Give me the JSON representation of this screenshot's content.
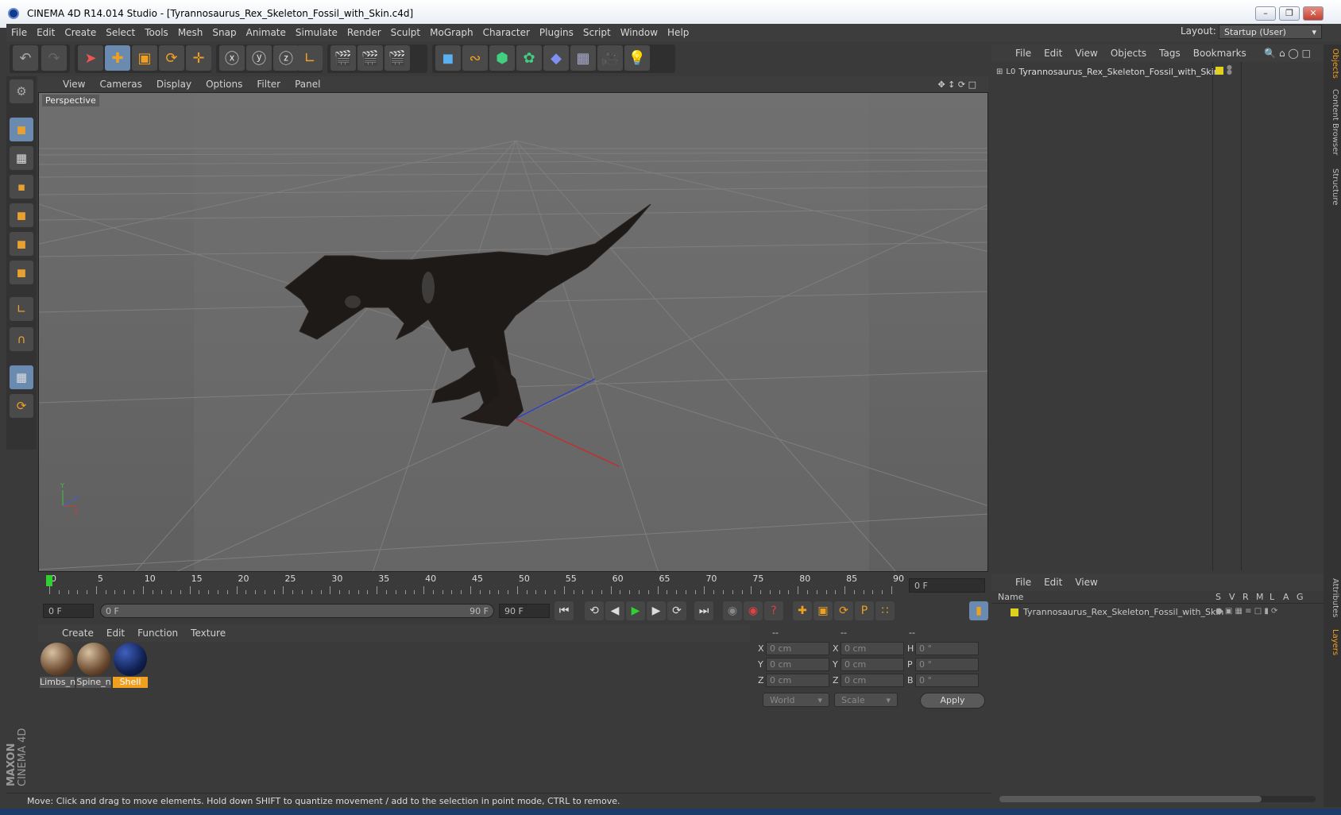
{
  "window": {
    "title": "CINEMA 4D R14.014 Studio - [Tyrannosaurus_Rex_Skeleton_Fossil_with_Skin.c4d]"
  },
  "menubar": {
    "items": [
      "File",
      "Edit",
      "Create",
      "Select",
      "Tools",
      "Mesh",
      "Snap",
      "Animate",
      "Simulate",
      "Render",
      "Sculpt",
      "MoGraph",
      "Character",
      "Plugins",
      "Script",
      "Window",
      "Help"
    ]
  },
  "layout": {
    "label": "Layout:",
    "value": "Startup (User)"
  },
  "viewport": {
    "menu": [
      "View",
      "Cameras",
      "Display",
      "Options",
      "Filter",
      "Panel"
    ],
    "label": "Perspective"
  },
  "timeline": {
    "ticks": [
      "0",
      "5",
      "10",
      "15",
      "20",
      "25",
      "30",
      "35",
      "40",
      "45",
      "50",
      "55",
      "60",
      "65",
      "70",
      "75",
      "80",
      "85",
      "90"
    ],
    "current_frame": "0 F",
    "start_field": "0 F",
    "range_start": "0 F",
    "range_end": "90 F",
    "end_field": "90 F"
  },
  "materials": {
    "menu": [
      "Create",
      "Edit",
      "Function",
      "Texture"
    ],
    "items": [
      {
        "name": "Limbs_n"
      },
      {
        "name": "Spine_n"
      },
      {
        "name": "Shell"
      }
    ]
  },
  "coords": {
    "headers": [
      "--",
      "--",
      "--"
    ],
    "rows": [
      {
        "a": "X",
        "av": "0 cm",
        "b": "X",
        "bv": "0 cm",
        "c": "H",
        "cv": "0 °"
      },
      {
        "a": "Y",
        "av": "0 cm",
        "b": "Y",
        "bv": "0 cm",
        "c": "P",
        "cv": "0 °"
      },
      {
        "a": "Z",
        "av": "0 cm",
        "b": "Z",
        "bv": "0 cm",
        "c": "B",
        "cv": "0 °"
      }
    ],
    "mode": "World",
    "transform": "Scale",
    "apply": "Apply"
  },
  "status": "Move: Click and drag to move elements. Hold down SHIFT to quantize movement / add to the selection in point mode, CTRL to remove.",
  "objects": {
    "menu": [
      "File",
      "Edit",
      "View",
      "Objects",
      "Tags",
      "Bookmarks"
    ],
    "items": [
      {
        "name": "Tyrannosaurus_Rex_Skeleton_Fossil_with_Skin"
      }
    ]
  },
  "layers": {
    "menu": [
      "File",
      "Edit",
      "View"
    ],
    "header": {
      "name": "Name",
      "cols": [
        "S",
        "V",
        "R",
        "M",
        "L",
        "A",
        "G"
      ]
    },
    "items": [
      {
        "name": "Tyrannosaurus_Rex_Skeleton_Fossil_with_Skin"
      }
    ]
  },
  "sidetabs": [
    "Objects",
    "Content Browser",
    "Structure",
    "Attributes",
    "Layers"
  ],
  "branding": {
    "maxon": "MAXON",
    "product": "CINEMA 4D"
  },
  "colors": {
    "accent": "#f0a020",
    "ui_bg": "#3a3a3a",
    "viewport_bg": "#6a6a6a",
    "layer_color": "#e0d020"
  }
}
